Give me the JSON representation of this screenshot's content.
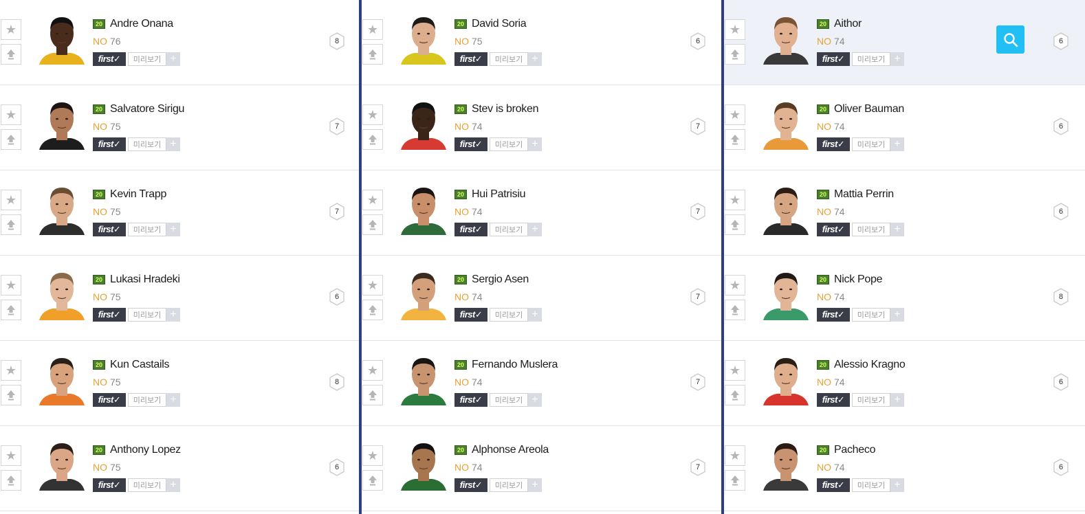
{
  "labels": {
    "position": "NO",
    "season": "20",
    "first": "first✓",
    "preview": "미리보기",
    "plus": "+",
    "star": "★"
  },
  "colors": {
    "divider": "#2e3d86",
    "position_text": "#e8a033",
    "season_badge_bg": "#4a7f2e",
    "first_bg": "#3a3d47",
    "search_bg": "#21bff3",
    "highlight_row": "#eef1f8"
  },
  "icons": {
    "star": "star-icon",
    "upgrade": "arrow-up-icon",
    "search": "search-icon",
    "level": "hexagon-icon"
  },
  "columns": [
    {
      "players": [
        {
          "name": "Andre Onana",
          "position": "NO",
          "ovr": "76",
          "level": "8",
          "skin": "#4a2c1c",
          "hair": "#111",
          "shirt": "#e8b21f"
        },
        {
          "name": "Salvatore Sirigu",
          "position": "NO",
          "ovr": "75",
          "level": "7",
          "skin": "#b07a58",
          "hair": "#1a1412",
          "shirt": "#1d1d1d"
        },
        {
          "name": "Kevin Trapp",
          "position": "NO",
          "ovr": "75",
          "level": "7",
          "skin": "#d9a886",
          "hair": "#6b4d33",
          "shirt": "#2d2d2d"
        },
        {
          "name": "Lukasi Hradeki",
          "position": "NO",
          "ovr": "75",
          "level": "6",
          "skin": "#e3b79a",
          "hair": "#8a6a4a",
          "shirt": "#f0a028"
        },
        {
          "name": "Kun Castails",
          "position": "NO",
          "ovr": "75",
          "level": "8",
          "skin": "#d8a27c",
          "hair": "#2a201a",
          "shirt": "#e8782a"
        },
        {
          "name": "Anthony Lopez",
          "position": "NO",
          "ovr": "75",
          "level": "6",
          "skin": "#dba587",
          "hair": "#2a1e18",
          "shirt": "#333"
        }
      ]
    },
    {
      "players": [
        {
          "name": "David Soria",
          "position": "NO",
          "ovr": "75",
          "level": "6",
          "skin": "#dcae8e",
          "hair": "#1e1a18",
          "shirt": "#d8c61e"
        },
        {
          "name": "Stev is broken",
          "position": "NO",
          "ovr": "74",
          "level": "7",
          "skin": "#3b2418",
          "hair": "#111",
          "shirt": "#d63a32"
        },
        {
          "name": "Hui Patrisiu",
          "position": "NO",
          "ovr": "74",
          "level": "7",
          "skin": "#c98e6a",
          "hair": "#1b1412",
          "shirt": "#2e6b3a"
        },
        {
          "name": "Sergio Asen",
          "position": "NO",
          "ovr": "74",
          "level": "7",
          "skin": "#d4a07c",
          "hair": "#3a2a20",
          "shirt": "#f2b441"
        },
        {
          "name": "Fernando Muslera",
          "position": "NO",
          "ovr": "74",
          "level": "7",
          "skin": "#c89470",
          "hair": "#1a1412",
          "shirt": "#2c7a3e"
        },
        {
          "name": "Alphonse Areola",
          "position": "NO",
          "ovr": "74",
          "level": "7",
          "skin": "#a8764e",
          "hair": "#111",
          "shirt": "#2b6e34"
        }
      ]
    },
    {
      "players": [
        {
          "name": "Aithor",
          "position": "NO",
          "ovr": "74",
          "level": "6",
          "skin": "#e0b091",
          "hair": "#7a5236",
          "shirt": "#3a3a3a"
        },
        {
          "name": "Oliver Bauman",
          "position": "NO",
          "ovr": "74",
          "level": "6",
          "skin": "#e2b393",
          "hair": "#5a3c26",
          "shirt": "#e89a38"
        },
        {
          "name": "Mattia Perrin",
          "position": "NO",
          "ovr": "74",
          "level": "6",
          "skin": "#d6a582",
          "hair": "#2c1e16",
          "shirt": "#2a2a2a"
        },
        {
          "name": "Nick Pope",
          "position": "NO",
          "ovr": "74",
          "level": "8",
          "skin": "#e3b597",
          "hair": "#221a16",
          "shirt": "#3a9a6a"
        },
        {
          "name": "Alessio Kragno",
          "position": "NO",
          "ovr": "74",
          "level": "6",
          "skin": "#dfae8c",
          "hair": "#2a1e16",
          "shirt": "#d8342e"
        },
        {
          "name": "Pacheco",
          "position": "NO",
          "ovr": "74",
          "level": "6",
          "skin": "#c99270",
          "hair": "#2a1c14",
          "shirt": "#3a3a3a"
        }
      ]
    }
  ]
}
